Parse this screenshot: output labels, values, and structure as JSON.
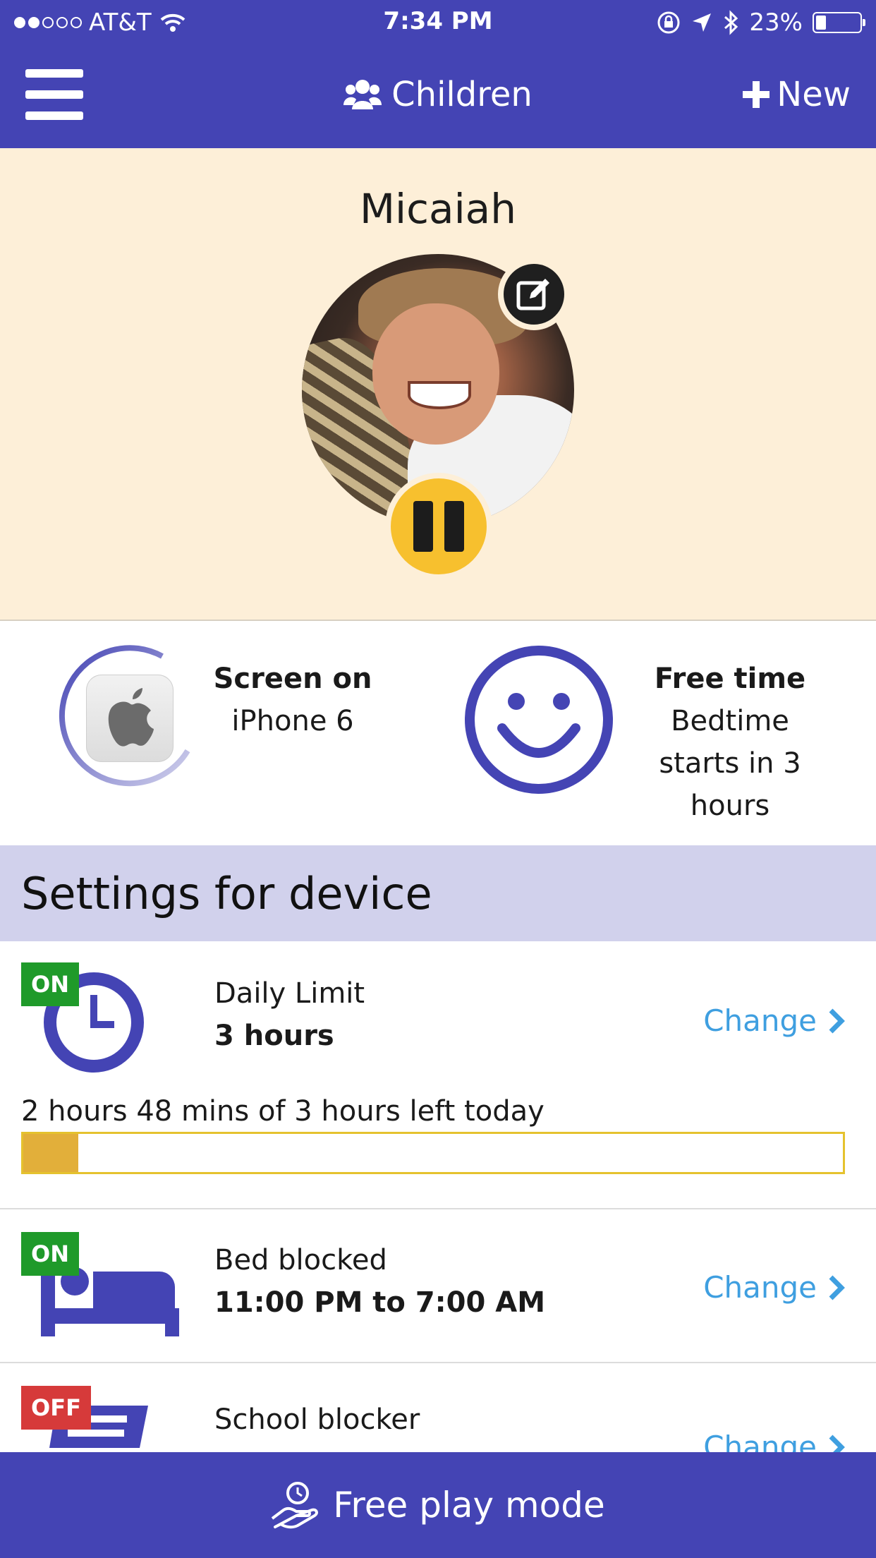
{
  "status_bar": {
    "carrier": "AT&T",
    "time": "7:34 PM",
    "battery_percent": "23%",
    "battery_level": 0.23
  },
  "header": {
    "title": "Children",
    "new_label": "New"
  },
  "profile": {
    "name": "Micaiah"
  },
  "device_status": {
    "title": "Screen on",
    "device": "iPhone 6"
  },
  "mode_status": {
    "title": "Free time",
    "line1": "Bedtime",
    "line2": "starts in 3",
    "line3": "hours"
  },
  "settings": {
    "heading": "Settings for device",
    "change_label": "Change",
    "daily_limit": {
      "badge": "ON",
      "label": "Daily Limit",
      "value": "3 hours",
      "remaining_text": "2 hours 48 mins of 3 hours left today",
      "used_fraction": 0.0667
    },
    "bed_blocked": {
      "badge": "ON",
      "label": "Bed blocked",
      "value": "11:00 PM to 7:00 AM"
    },
    "school_blocker": {
      "badge": "OFF",
      "label": "School blocker"
    }
  },
  "bottom_bar": {
    "label": "Free play mode"
  },
  "colors": {
    "brand": "#4444b4",
    "on_badge": "#1f9a2a",
    "off_badge": "#d63a3a",
    "link": "#3f9fe0",
    "pause": "#f7c02e"
  }
}
